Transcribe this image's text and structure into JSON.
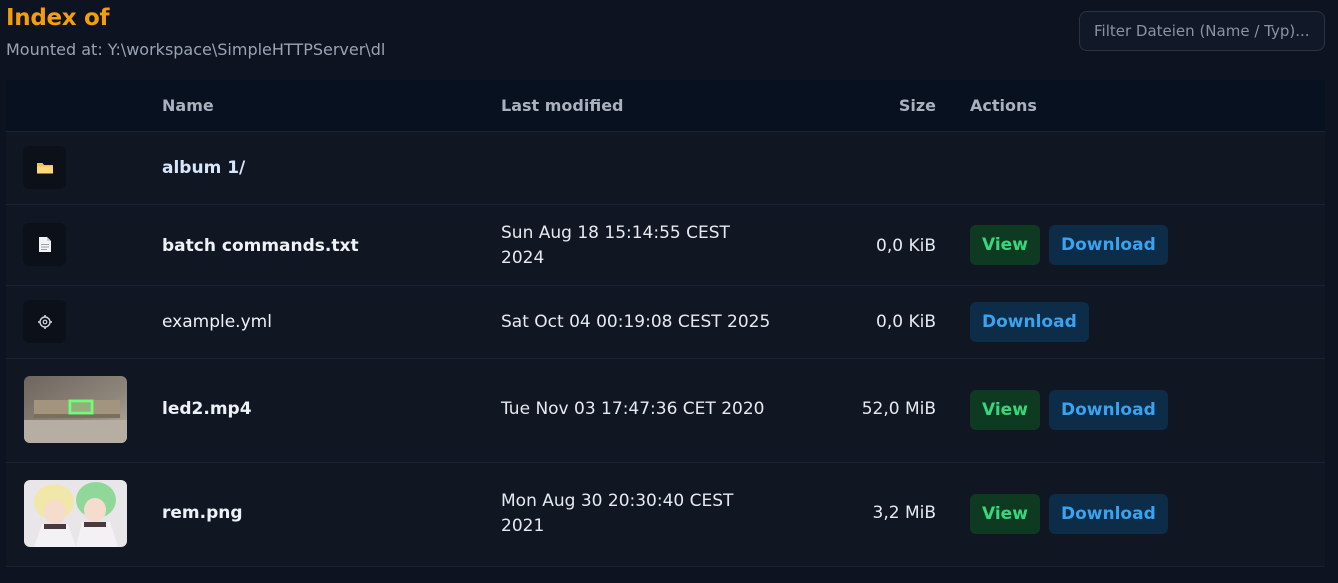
{
  "header": {
    "title": "Index of",
    "mounted": "Mounted at: Y:\\workspace\\SimpleHTTPServer\\dl"
  },
  "filter": {
    "placeholder": "Filter Dateien (Name / Typ)..."
  },
  "columns": {
    "name": "Name",
    "modified": "Last modified",
    "size": "Size",
    "actions": "Actions"
  },
  "buttons": {
    "view": "View",
    "download": "Download"
  },
  "rows": [
    {
      "name": "album 1/",
      "type": "folder",
      "icon": "folder-icon",
      "modified": "",
      "size": ""
    },
    {
      "name": "batch commands.txt",
      "type": "text",
      "icon": "document-icon",
      "modified": "Sun Aug 18 15:14:55 CEST 2024",
      "size": "0,0 KiB"
    },
    {
      "name": "example.yml",
      "type": "config",
      "icon": "gear-icon",
      "modified": "Sat Oct 04 00:19:08 CEST 2025",
      "size": "0,0 KiB"
    },
    {
      "name": "led2.mp4",
      "type": "video",
      "icon": "video-thumbnail",
      "modified": "Tue Nov 03 17:47:36 CET 2020",
      "size": "52,0 MiB"
    },
    {
      "name": "rem.png",
      "type": "image",
      "icon": "image-thumbnail",
      "modified": "Mon Aug 30 20:30:40 CEST 2021",
      "size": "3,2 MiB"
    }
  ]
}
